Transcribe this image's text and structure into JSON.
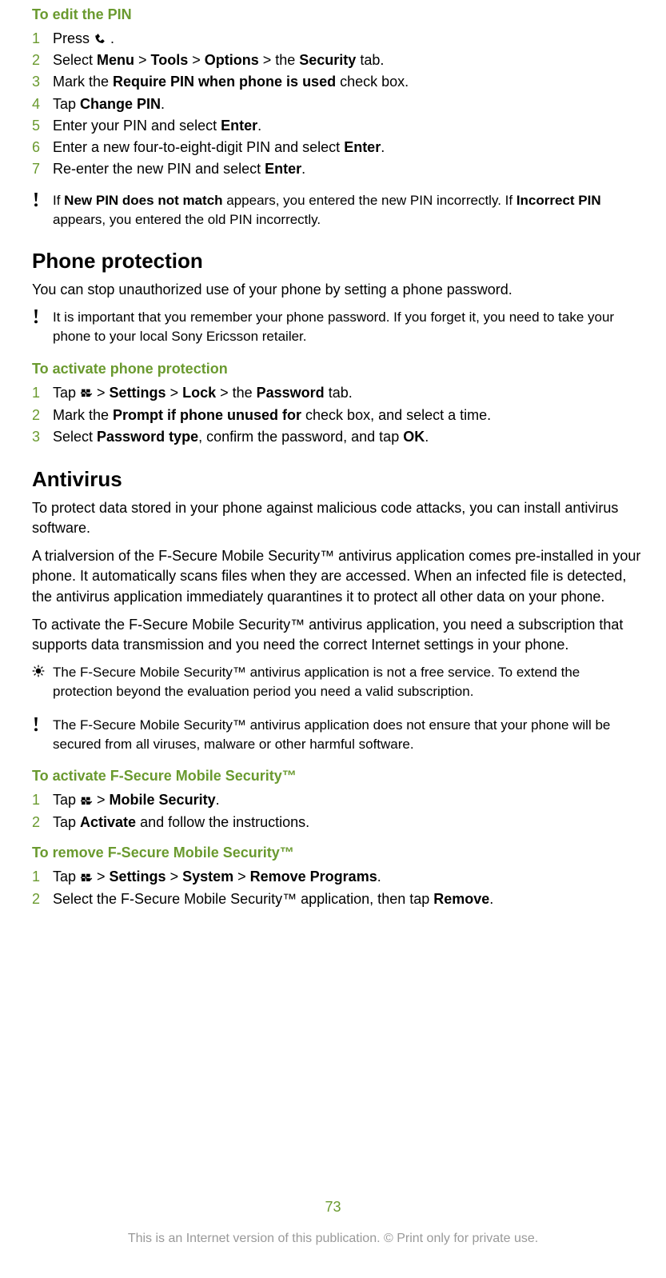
{
  "edit_pin": {
    "heading": "To edit the PIN",
    "step1_a": "Press ",
    "step1_b": " .",
    "step2_a": "Select ",
    "step2_menu": "Menu",
    "step2_gt1": " > ",
    "step2_tools": "Tools",
    "step2_gt2": " > ",
    "step2_options": "Options",
    "step2_gt3": " > the ",
    "step2_security": "Security",
    "step2_end": " tab.",
    "step3_a": "Mark the ",
    "step3_b": "Require PIN when phone is used",
    "step3_c": " check box.",
    "step4_a": "Tap ",
    "step4_b": "Change PIN",
    "step4_c": ".",
    "step5_a": "Enter your PIN and select ",
    "step5_b": "Enter",
    "step5_c": ".",
    "step6_a": "Enter a new four-to-eight-digit PIN and select ",
    "step6_b": "Enter",
    "step6_c": ".",
    "step7_a": "Re-enter the new PIN and select ",
    "step7_b": "Enter",
    "step7_c": ".",
    "note_a": "If ",
    "note_b": "New PIN does not match",
    "note_c": " appears, you entered the new PIN incorrectly. If ",
    "note_d": "Incorrect PIN",
    "note_e": " appears, you entered the old PIN incorrectly."
  },
  "phone_protection": {
    "heading": "Phone protection",
    "intro": "You can stop unauthorized use of your phone by setting a phone password.",
    "note": "It is important that you remember your phone password. If you forget it, you need to take your phone to your local Sony Ericsson retailer.",
    "activate_heading": "To activate phone protection",
    "step1_a": "Tap ",
    "step1_b": " > ",
    "step1_settings": "Settings",
    "step1_gt2": " > ",
    "step1_lock": "Lock",
    "step1_gt3": " > the ",
    "step1_password": "Password",
    "step1_end": " tab.",
    "step2_a": "Mark the ",
    "step2_b": "Prompt if phone unused for",
    "step2_c": " check box, and select a time.",
    "step3_a": "Select ",
    "step3_b": "Password type",
    "step3_c": ", confirm the password, and tap ",
    "step3_d": "OK",
    "step3_e": "."
  },
  "antivirus": {
    "heading": "Antivirus",
    "p1": "To protect data stored in your phone against malicious code attacks, you can install antivirus software.",
    "p2": "A trialversion of the F-Secure Mobile Security™ antivirus application comes pre-installed in your phone. It automatically scans files when they are accessed. When an infected file is detected, the antivirus application immediately quarantines it to protect all other data on your phone.",
    "p3": "To activate the F-Secure Mobile Security™ antivirus application, you need a subscription that supports data transmission and you need the correct Internet settings in your phone.",
    "tip": "The F-Secure Mobile Security™ antivirus application is not a free service. To extend the protection beyond the evaluation period you need a valid subscription.",
    "warn": "The F-Secure Mobile Security™ antivirus application does not ensure that your phone will be secured from all viruses, malware or other harmful software.",
    "activate_heading": "To activate F-Secure Mobile Security™",
    "act_step1_a": "Tap ",
    "act_step1_b": " > ",
    "act_step1_c": "Mobile Security",
    "act_step1_d": ".",
    "act_step2_a": "Tap ",
    "act_step2_b": "Activate",
    "act_step2_c": " and follow the instructions.",
    "remove_heading": "To remove F-Secure Mobile Security™",
    "rem_step1_a": "Tap ",
    "rem_step1_b": " > ",
    "rem_step1_settings": "Settings",
    "rem_step1_gt2": " > ",
    "rem_step1_system": "System",
    "rem_step1_gt3": " > ",
    "rem_step1_remove": "Remove Programs",
    "rem_step1_end": ".",
    "rem_step2_a": "Select the F-Secure Mobile Security™ application, then tap ",
    "rem_step2_b": "Remove",
    "rem_step2_c": "."
  },
  "footer": {
    "page": "73",
    "line": "This is an Internet version of this publication. © Print only for private use."
  },
  "nums": [
    "1",
    "2",
    "3",
    "4",
    "5",
    "6",
    "7"
  ]
}
